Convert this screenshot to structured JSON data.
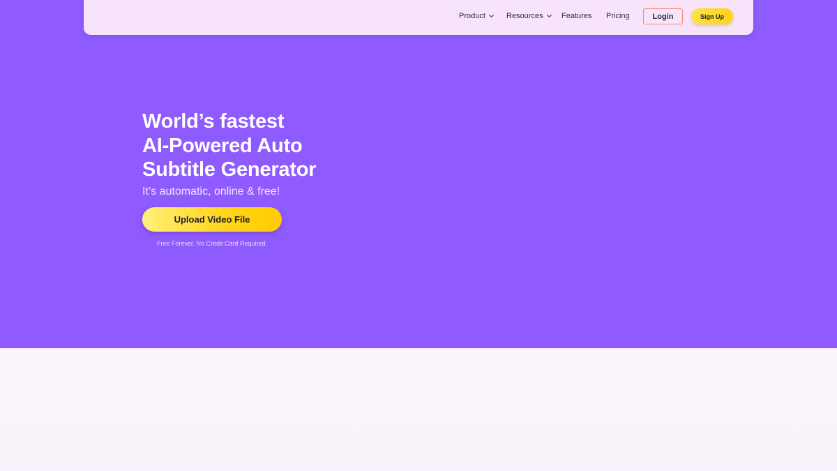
{
  "nav": {
    "links": [
      {
        "label": "Product",
        "has_dropdown": true
      },
      {
        "label": "Resources",
        "has_dropdown": true
      },
      {
        "label": "Features",
        "has_dropdown": false
      },
      {
        "label": "Pricing",
        "has_dropdown": false
      }
    ],
    "login_label": "Login",
    "signup_label": "Sign Up"
  },
  "hero": {
    "title_lines": [
      "World’s fastest",
      "AI-Powered Auto",
      "Subtitle Generator"
    ],
    "subtitle": "It’s automatic, online & free!",
    "cta_label": "Upload Video File",
    "note": "Free Forever. No Credit Card Required."
  },
  "colors": {
    "hero_bg": "#8f5bff",
    "nav_bg": "#f7e4fb",
    "cta_yellow": "#ffd51c",
    "login_border": "#f08a6a"
  }
}
